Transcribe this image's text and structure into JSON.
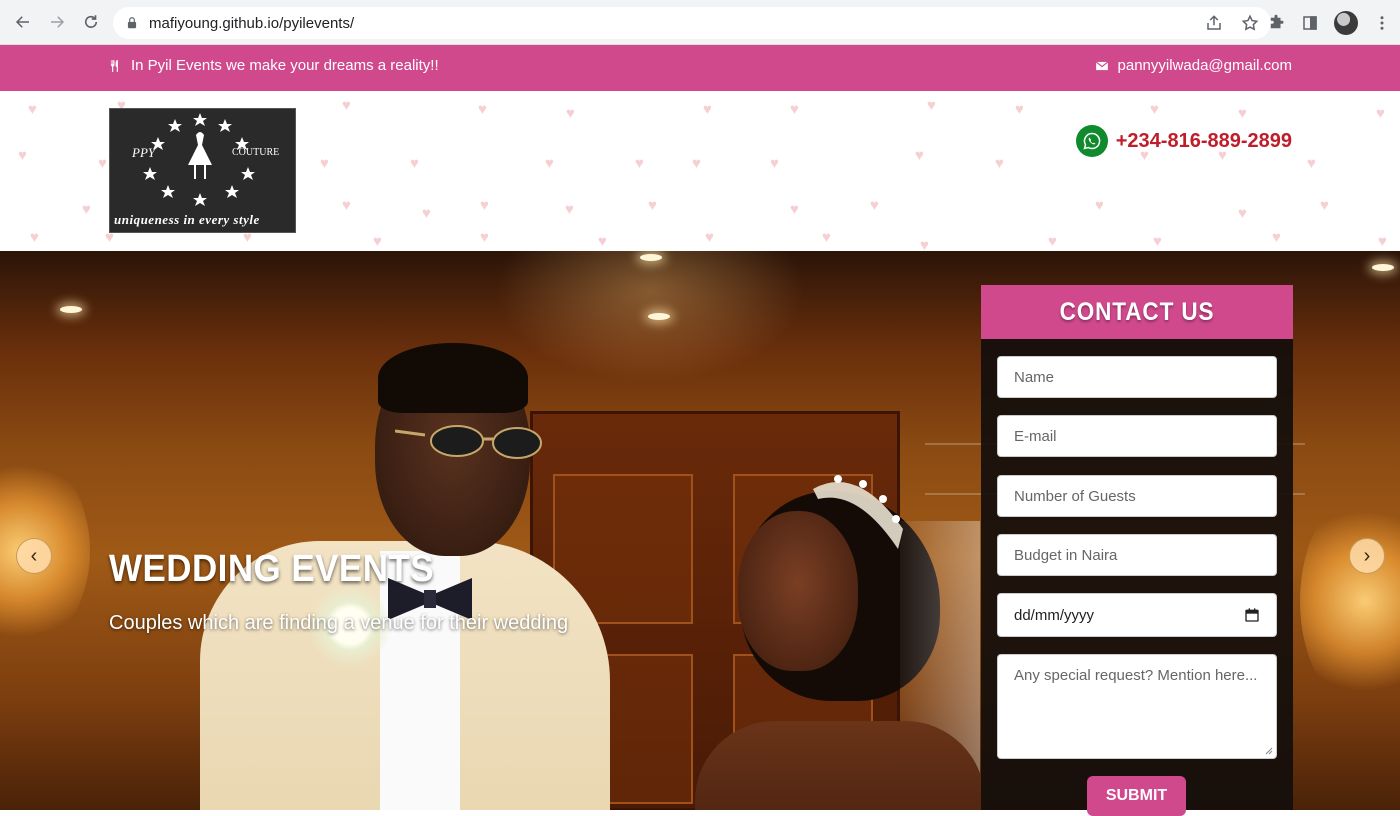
{
  "browser": {
    "url": "mafiyoung.github.io/pyilevents/"
  },
  "topbar": {
    "tagline": "In Pyil Events we make your dreams a reality!!",
    "email": "pannyyilwada@gmail.com",
    "tagline_icon": "utensils-icon",
    "email_icon": "envelope-icon"
  },
  "header": {
    "logo": {
      "left_text": "PPY",
      "right_text": "COUTURE",
      "tagline": "uniqueness in every style"
    },
    "phone": "+234-816-889-2899",
    "phone_icon": "whatsapp-icon"
  },
  "hero": {
    "title": "WEDDING EVENTS",
    "subtitle": "Couples which are finding a venue for their wedding",
    "prev_label": "‹",
    "next_label": "›"
  },
  "contact": {
    "title": "CONTACT US",
    "fields": {
      "name": "Name",
      "email": "E-mail",
      "guests": "Number of Guests",
      "budget": "Budget in Naira",
      "date": "dd/mm/yyyy",
      "request": "Any special request? Mention here..."
    },
    "submit": "SUBMIT"
  },
  "colors": {
    "brand_pink": "#d1498d",
    "phone_red": "#c01d2a",
    "whatsapp_green": "#0f8a2c"
  }
}
